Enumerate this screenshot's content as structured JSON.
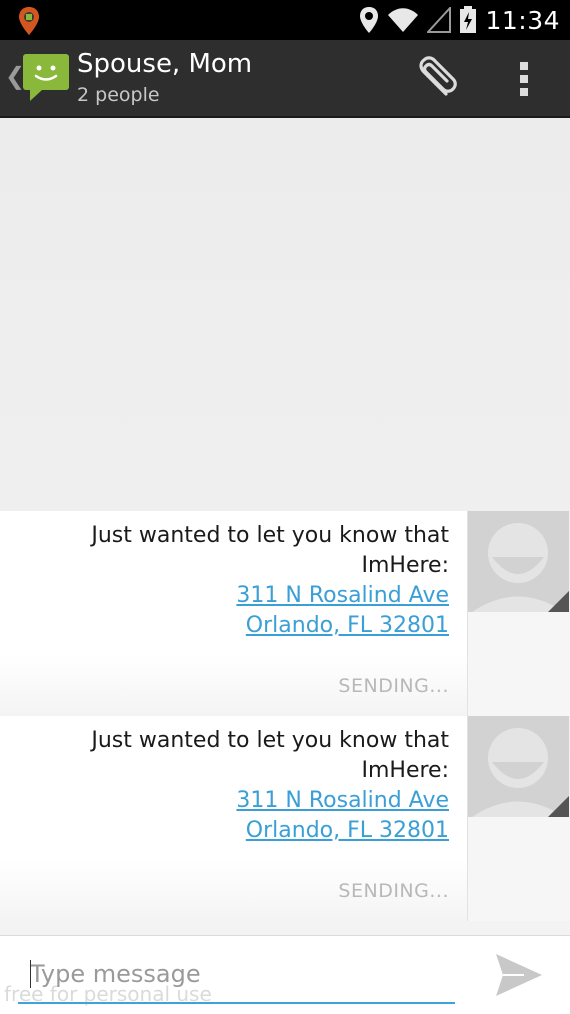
{
  "status_bar": {
    "time": "11:34",
    "icons": [
      "notification-app-icon",
      "location-pin-icon",
      "wifi-icon",
      "cell-signal-icon",
      "battery-charging-icon"
    ]
  },
  "action_bar": {
    "title": "Spouse, Mom",
    "subtitle": "2 people",
    "icons": [
      "up-caret-icon",
      "messaging-app-icon",
      "attach-icon",
      "overflow-menu-icon"
    ]
  },
  "messages": [
    {
      "text": "Just wanted to let you know that ImHere:",
      "address_line1": "311 N Rosalind Ave",
      "address_line2": "Orlando, FL 32801",
      "status": "SENDING..."
    },
    {
      "text": "Just wanted to let you know that ImHere:",
      "address_line1": "311 N Rosalind Ave",
      "address_line2": "Orlando, FL 32801",
      "status": "SENDING..."
    }
  ],
  "compose": {
    "placeholder": "Type message",
    "watermark": "free for personal use"
  },
  "colors": {
    "accent": "#3ea3d8",
    "link": "#3a9fd6",
    "app_icon_green": "#8ab83a",
    "action_bar": "#2e2e2e"
  }
}
